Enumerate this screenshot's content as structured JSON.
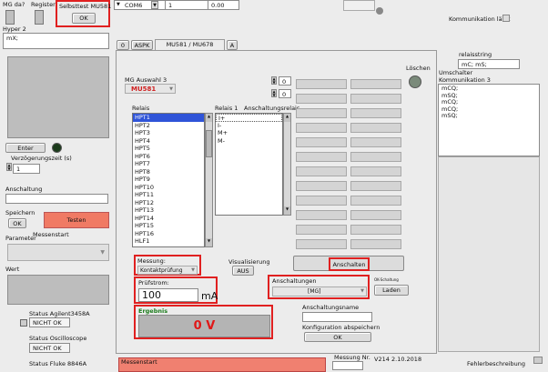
{
  "top": {
    "mg_da_label": "MG da?",
    "register_label": "Register",
    "selbsttest_label": "Selbsttest MU581",
    "ok_label": "OK",
    "port_value": "COM6",
    "num1_value": "1",
    "num2_value": "0.00",
    "kommunikation_label": "Kommunikation läuft",
    "hyper_label": "Hyper 2",
    "hyper_value": "mX;"
  },
  "tabs": [
    "0",
    "ASPK",
    "MU581 / MU678",
    "A"
  ],
  "left": {
    "enter_label": "Enter",
    "verz_label": "Verzögerungszeit (s)",
    "verz_value": "1",
    "anschaltung_label": "Anschaltung",
    "speichern_label": "Speichern",
    "speichern_ok": "OK",
    "testen_label": "Testen",
    "parameter_label": "Parameter",
    "messenstart_label": "Messenstart",
    "wert_label": "Wert",
    "status_agilent_label": "Status Agilent3458A",
    "status_agilent_value": "NICHT OK",
    "status_osc_label": "Status Oscilloscope",
    "status_osc_value": "NICHT OK",
    "status_fluke_label": "Status Fluke 8846A"
  },
  "main": {
    "mg_auswahl_label": "MG Auswahl 3",
    "mg_auswahl_value": "MU581",
    "relais_label": "Relais",
    "relais_items": [
      "HPT1",
      "HPT2",
      "HPT3",
      "HPT4",
      "HPT5",
      "HPT6",
      "HPT7",
      "HPT8",
      "HPT9",
      "HPT10",
      "HPT11",
      "HPT12",
      "HPT13",
      "HPT14",
      "HPT15",
      "HPT16",
      "HLF1"
    ],
    "relais1_label": "Relais 1",
    "anschaltungsrelais_label": "Anschaltungsrelais",
    "relais1_items": [
      "I+",
      "I-",
      "M+",
      "M-"
    ],
    "spin_value_1": "0",
    "spin_value_2": "0",
    "loeschen_label": "Löschen",
    "messung_label": "Messung:",
    "messung_value": "Kontaktprüfung",
    "visualisierung_label": "Visualisierung",
    "aus_label": "AUS",
    "anschalten_label": "Anschalten",
    "pruefstrom_label": "Prüfstrom:",
    "pruefstrom_value": "100",
    "pruefstrom_unit": "mA",
    "anschaltungen_label": "Anschaltungen",
    "anschaltungen_value": "[MG]",
    "ok_schaltung_label": "OK-Schaltung",
    "laden_label": "Laden",
    "ergebnis_label": "Ergebnis",
    "ergebnis_value": "0 V",
    "anschaltungsname_label": "Anschaltungsname",
    "konfig_label": "Konfiguration abspeichern",
    "konfig_ok": "OK",
    "messstart_bottom": "Messenstart",
    "messung_nr_label": "Messung Nr.",
    "version_label": "V214",
    "version_date": "2.10.2018",
    "fehlerbeschreibung_label": "Fehlerbeschreibung"
  },
  "right": {
    "relaisstring_label": "relaisstring",
    "relaisstring_value": "mC; mS;",
    "umschalter_label": "Umschalter",
    "kommunikation3_label": "Kommunikation 3",
    "lines": [
      "mCQ;",
      "mSQ;",
      "mCQ;",
      "mCQ;",
      "mSQ;"
    ]
  },
  "colors": {
    "accent_red": "#e02020",
    "tab_active": "#ececec",
    "selection_blue": "#2f54d8",
    "testen_bg": "#f07a64"
  }
}
